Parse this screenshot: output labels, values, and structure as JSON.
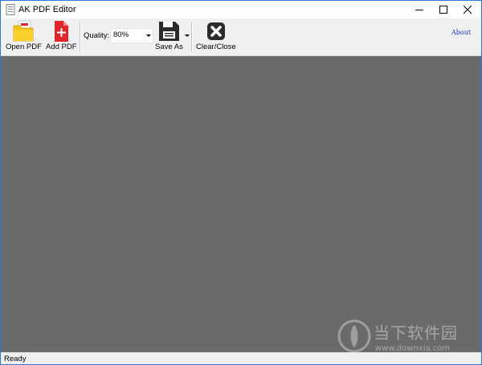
{
  "window": {
    "title": "AK PDF Editor",
    "icons": [
      "app-icon",
      "minimize-icon",
      "maximize-icon",
      "close-icon"
    ]
  },
  "toolbar": {
    "open_pdf": "Open PDF",
    "add_pdf": "Add PDF",
    "quality_label": "Quality:",
    "quality_value": "80%",
    "save_as": "Save As",
    "clear_close": "Clear/Close",
    "about": "About"
  },
  "status": {
    "text": "Ready"
  },
  "watermark": {
    "name": "当下软件园",
    "url": "www.downxia.com"
  },
  "colors": {
    "canvas": "#6a6a6a",
    "toolbar": "#f0f0f0",
    "about_link": "#1530c8",
    "add_pdf_red": "#e0262c",
    "open_pdf_yellow": "#f5c21a"
  }
}
